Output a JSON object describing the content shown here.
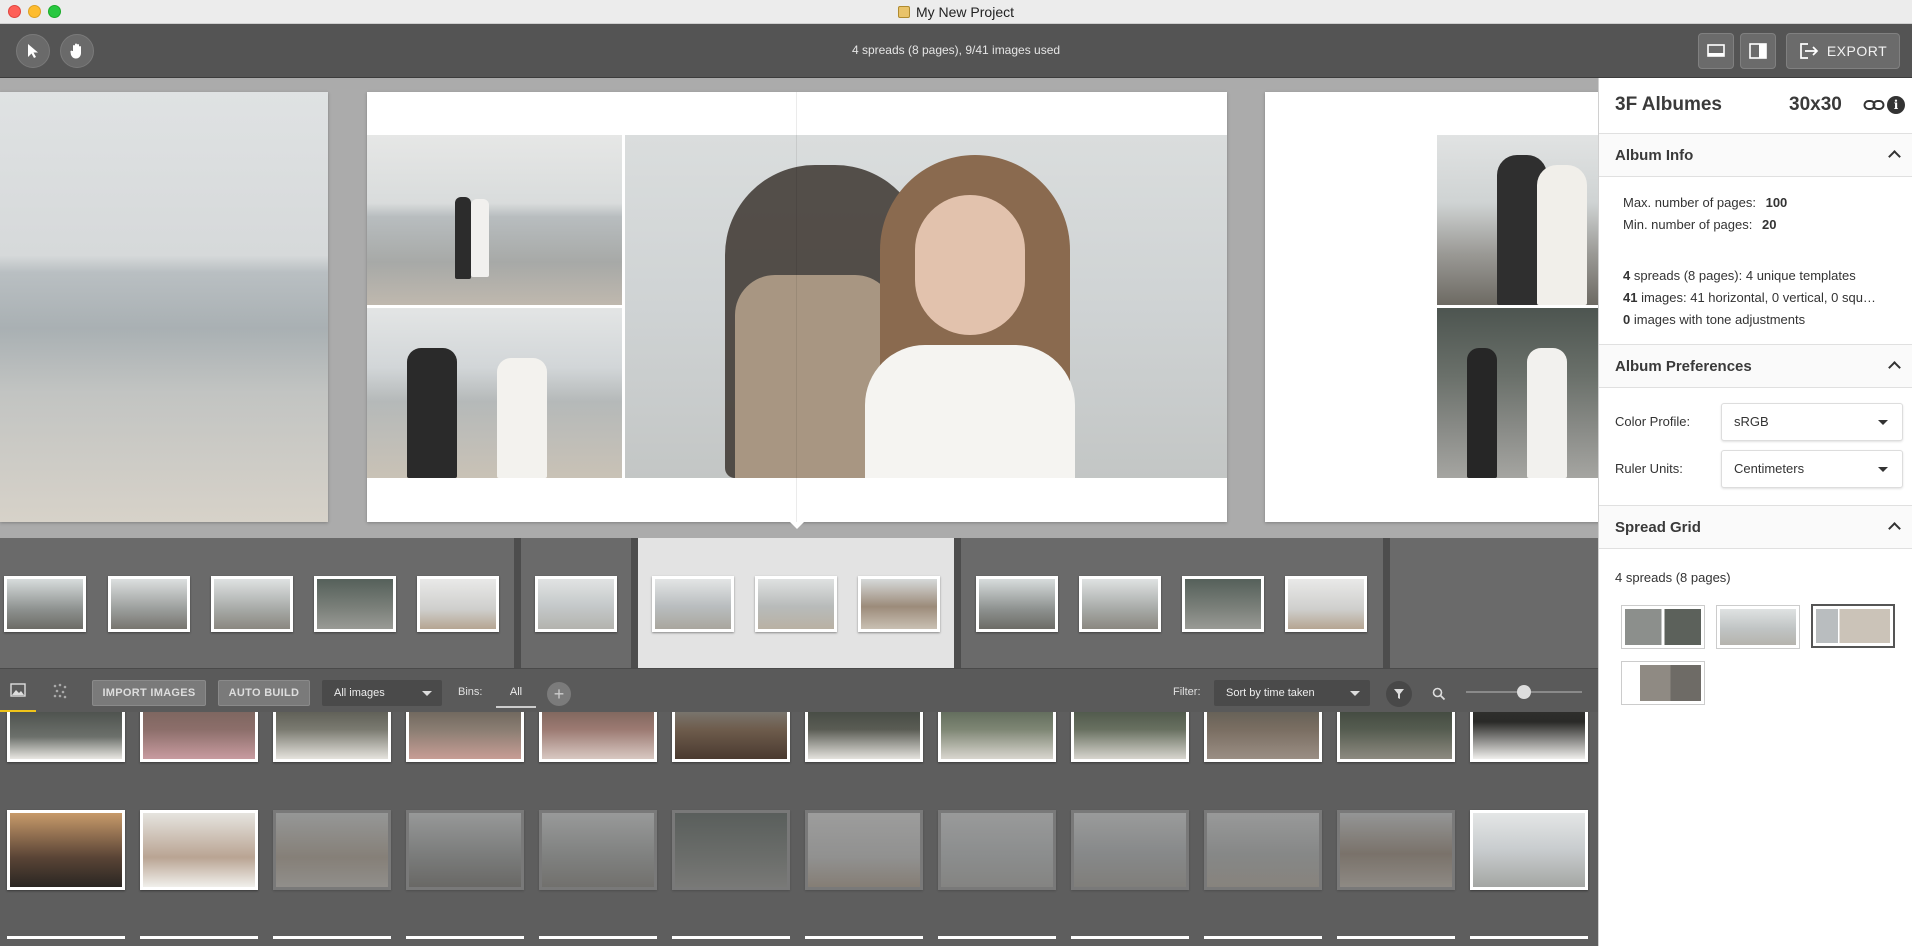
{
  "window": {
    "title": "My New Project"
  },
  "toolbar": {
    "status": "4 spreads (8 pages), 9/41 images used",
    "export_label": "EXPORT"
  },
  "panel": {
    "product_name": "3F Albumes",
    "size": "30x30",
    "album_info": {
      "header": "Album Info",
      "max_pages_label": "Max. number of pages:",
      "max_pages_value": "100",
      "min_pages_label": "Min. number of pages:",
      "min_pages_value": "20",
      "spreads_count": "4",
      "spreads_text": "spreads (8 pages): 4 unique templates",
      "images_count": "41",
      "images_text": "images: 41 horizontal, 0 vertical, 0 squ…",
      "tone_count": "0",
      "tone_text": "images with tone adjustments"
    },
    "album_preferences": {
      "header": "Album Preferences",
      "color_profile_label": "Color Profile:",
      "color_profile_value": "sRGB",
      "ruler_units_label": "Ruler Units:",
      "ruler_units_value": "Centimeters"
    },
    "spread_grid": {
      "header": "Spread Grid",
      "summary": "4 spreads (8 pages)"
    }
  },
  "images_bar": {
    "import_label": "IMPORT IMAGES",
    "auto_build_label": "AUTO BUILD",
    "source_value": "All images",
    "bins_label": "Bins:",
    "bins_all": "All",
    "filter_label": "Filter:",
    "sort_value": "Sort by time taken",
    "zoom_fraction": 0.5
  },
  "colors": {
    "accent": "#f0c419",
    "panel_bg": "#ffffff",
    "canvas_bg": "#ababab"
  }
}
